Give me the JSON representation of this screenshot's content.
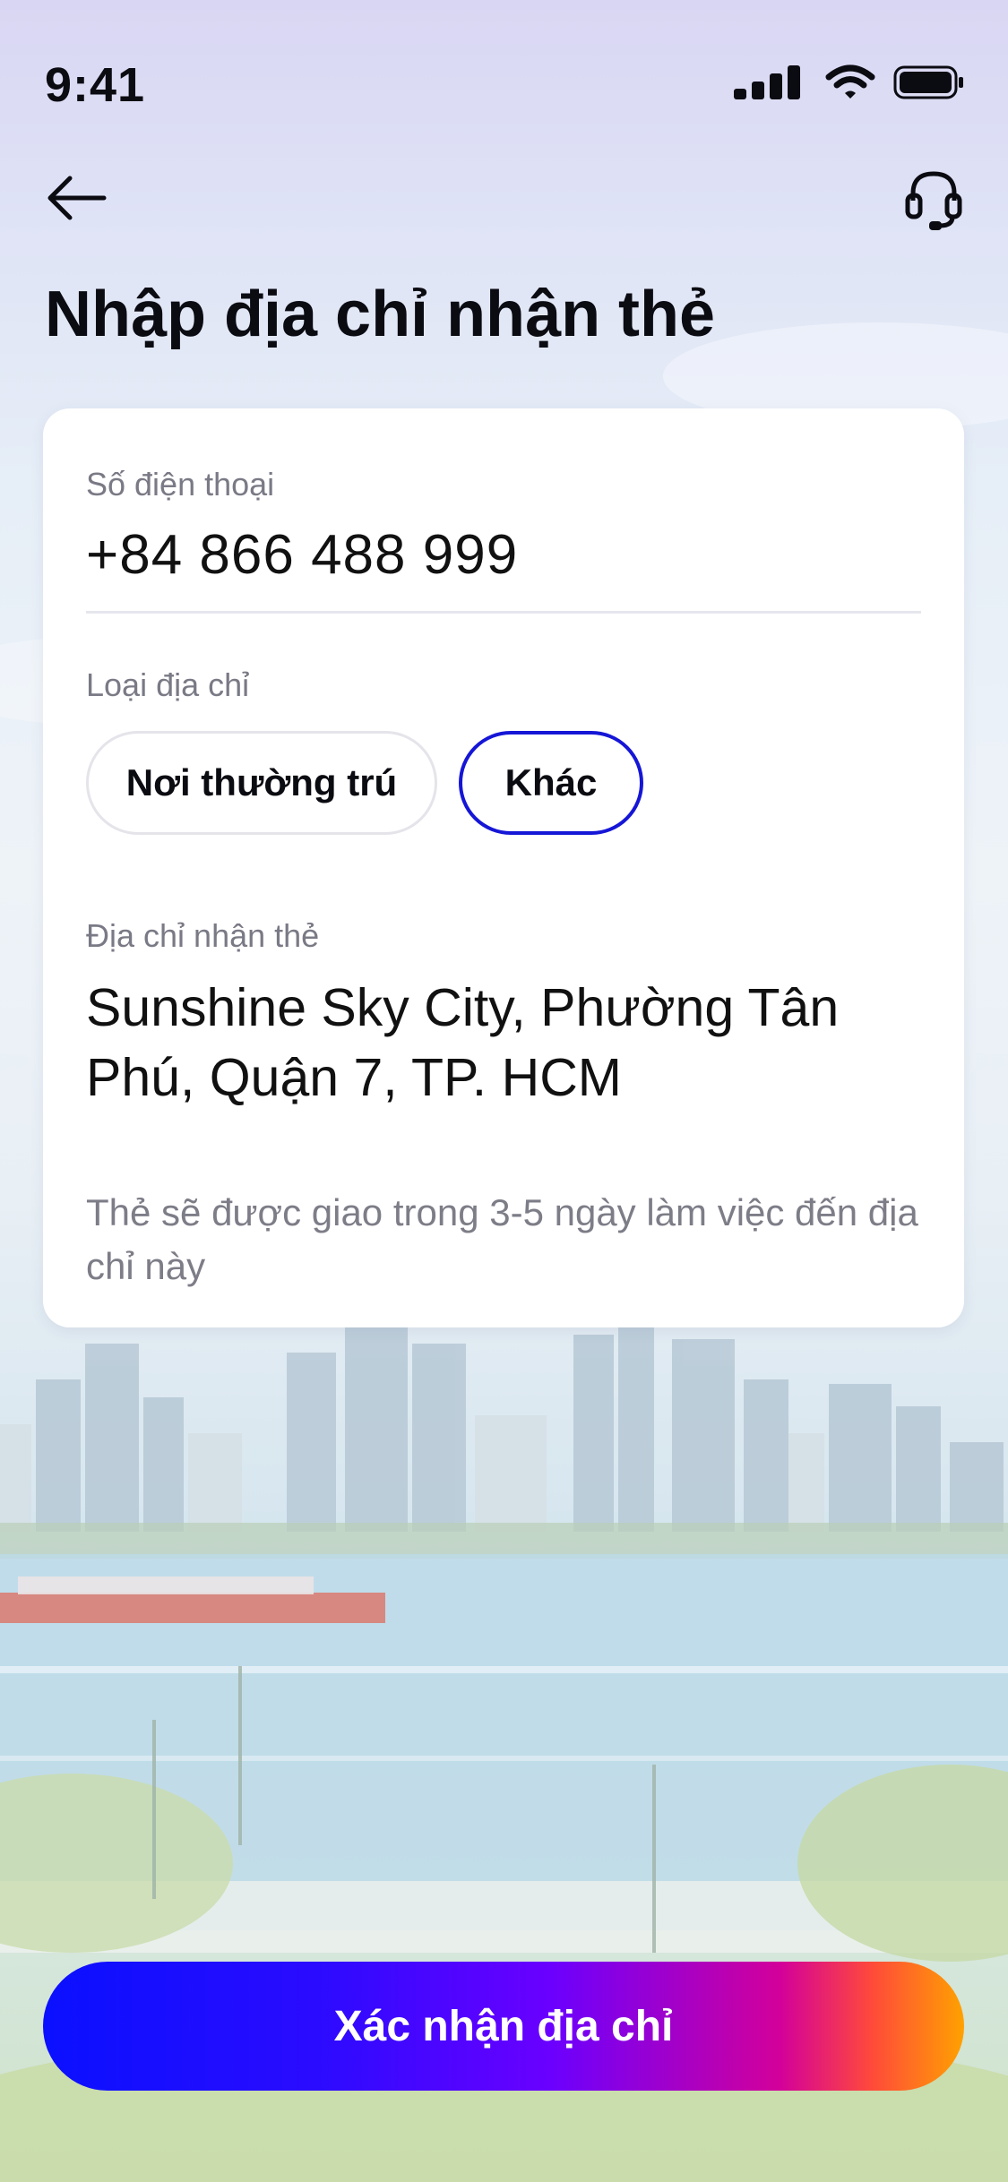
{
  "status_bar": {
    "time": "9:41"
  },
  "nav": {
    "back_icon": "arrow-left-icon",
    "support_icon": "headset-icon"
  },
  "page": {
    "title": "Nhập địa chỉ nhận thẻ"
  },
  "form": {
    "phone_label": "Số điện thoại",
    "phone_value": "+84 866 488 999",
    "address_type_label": "Loại địa chỉ",
    "address_types": [
      "Nơi thường trú",
      "Khác"
    ],
    "selected_address_type": "Khác",
    "address_label": "Địa chỉ nhận thẻ",
    "address_value": "Sunshine Sky City, Phường Tân Phú, Quận 7, TP. HCM",
    "delivery_note": "Thẻ sẽ được giao trong 3-5 ngày làm việc đến địa chỉ này"
  },
  "cta": {
    "label": "Xác nhận địa chỉ"
  },
  "colors": {
    "accent": "#1516D6",
    "cta_start": "#0A10FF",
    "cta_end": "#FFA100"
  }
}
